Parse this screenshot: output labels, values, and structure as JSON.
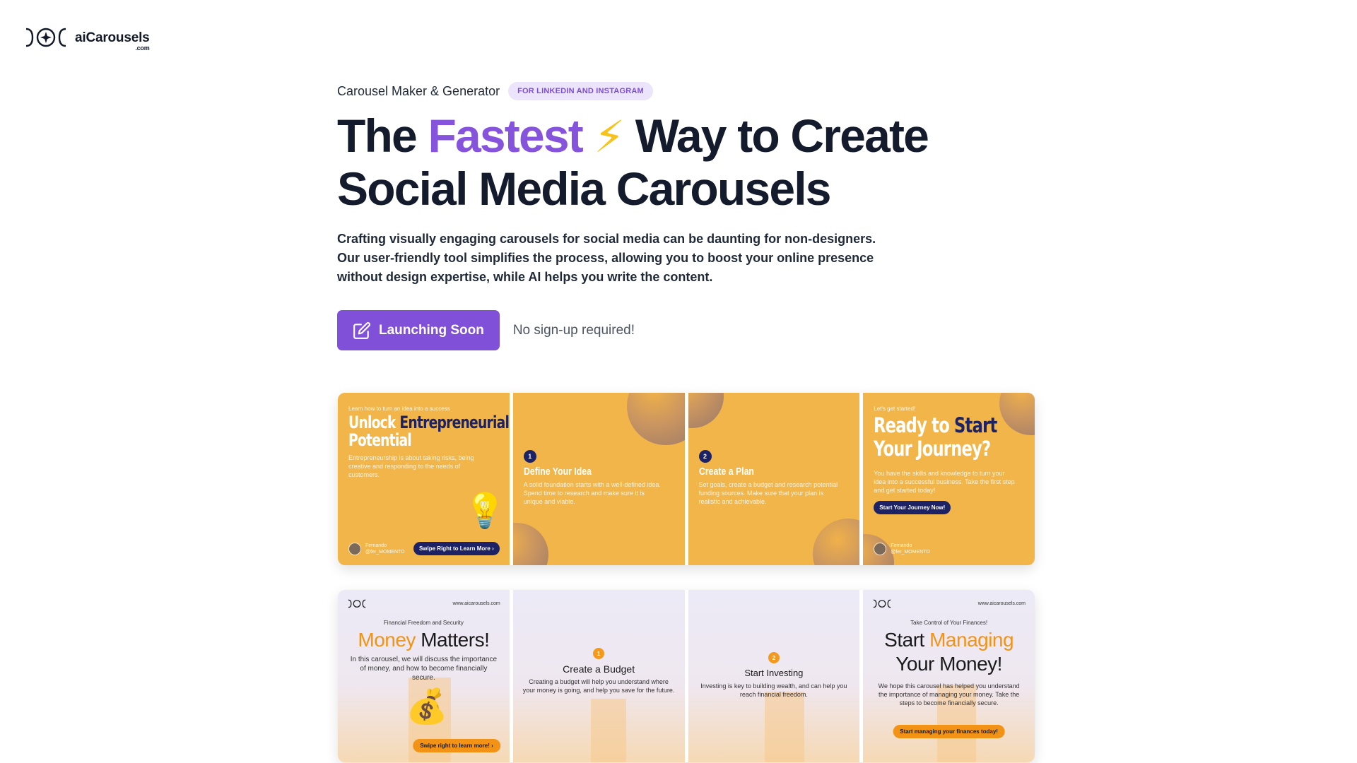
{
  "brand": {
    "name": "aiCarousels",
    "domain_suffix": ".com",
    "logo_icon": "brackets-sparkle-logo-icon"
  },
  "hero": {
    "eyebrow": "Carousel Maker & Generator",
    "badge": "FOR LINKEDIN AND INSTAGRAM",
    "headline_part1": "The ",
    "headline_highlight": "Fastest",
    "headline_emoji": "⚡",
    "headline_part2": " Way to Create",
    "headline_line2": "Social Media Carousels",
    "description": "Crafting visually engaging carousels for social media can be daunting for non-designers. Our user-friendly tool simplifies the process, allowing you to boost your online presence without design expertise, while AI helps you write the content.",
    "cta_label": "Launching Soon",
    "cta_icon": "edit-icon",
    "cta_note": "No sign-up required!",
    "accent_color": "#8653dd"
  },
  "carousel_entrepreneur": {
    "slide1": {
      "small": "Learn how to turn an idea into a success",
      "title_white": "Unlock ",
      "title_dark": "Entrepreneurial",
      "title_white2": "Potential",
      "text": "Entrepreneurship is about taking risks, being creative and responding to the needs of customers.",
      "author_name": "Fernando",
      "author_handle": "@fer_MOMENTO",
      "button": "Swipe Right to Learn More ›"
    },
    "slide2": {
      "num": "1",
      "title": "Define Your Idea",
      "text": "A solid foundation starts with a well-defined idea. Spend time to research and make sure it is unique and viable."
    },
    "slide3": {
      "num": "2",
      "title": "Create a Plan",
      "text": "Set goals, create a budget and research potential funding sources. Make sure that your plan is realistic and achievable."
    },
    "slide4": {
      "small": "Let's get started!",
      "title_white": "Ready to ",
      "title_dark": "Start",
      "title_white2": "Your Journey?",
      "text": "You have the skills and knowledge to turn your idea into a successful business. Take the first step and get started today!",
      "button": "Start Your Journey Now!",
      "author_name": "Fernando",
      "author_handle": "@fer_MOMENTO"
    }
  },
  "carousel_money": {
    "url": "www.aicarousels.com",
    "slide1": {
      "kicker": "Financial Freedom and Security",
      "title_orange": "Money",
      "title_dark": " Matters!",
      "text": "In this carousel, we will discuss the importance of money, and how to become financially secure.",
      "button": "Swipe right to learn more! ›"
    },
    "slide2": {
      "num": "1",
      "title": "Create a Budget",
      "text": "Creating a budget will help you understand where your money is going, and help you save for the future."
    },
    "slide3": {
      "num": "2",
      "title": "Start Investing",
      "text": "Investing is key to building wealth, and can help you reach financial freedom."
    },
    "slide4": {
      "kicker": "Take Control of Your Finances!",
      "title_dark": "Start ",
      "title_orange": "Managing",
      "title_line2": "Your Money!",
      "text": "We hope this carousel has helped you understand the importance of managing your money. Take the steps to become financially secure.",
      "button": "Start managing your finances today!"
    }
  }
}
